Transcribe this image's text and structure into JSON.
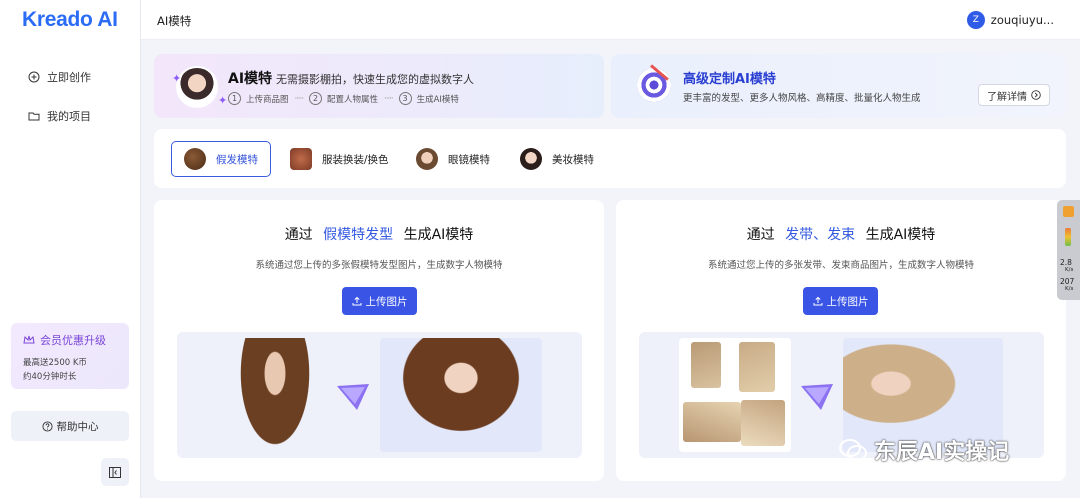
{
  "app": {
    "logo": "Kreado AI",
    "page_title": "AI模特"
  },
  "user": {
    "initial": "Z",
    "name": "zouqiuyu..."
  },
  "sidebar": {
    "items": [
      {
        "label": "立即创作",
        "icon": "plus-circle-icon"
      },
      {
        "label": "我的项目",
        "icon": "folder-icon"
      }
    ],
    "vip": {
      "title": "会员优惠升级",
      "line1": "最高送2500 K币",
      "line2": "约40分钟时长"
    },
    "help": "帮助中心"
  },
  "banner_left": {
    "title": "AI模特",
    "desc": "无需摄影棚拍，快速生成您的虚拟数字人",
    "steps": [
      {
        "num": "1",
        "label": "上传商品图"
      },
      {
        "num": "2",
        "label": "配置人物属性"
      },
      {
        "num": "3",
        "label": "生成AI模特"
      }
    ],
    "dots": "·····"
  },
  "banner_right": {
    "title": "高级定制AI模特",
    "desc": "更丰富的发型、更多人物风格、高精度、批量化人物生成",
    "button": "了解详情"
  },
  "tabs": [
    {
      "label": "假发模特",
      "active": true
    },
    {
      "label": "服装换装/换色",
      "active": false
    },
    {
      "label": "眼镜模特",
      "active": false
    },
    {
      "label": "美妆模特",
      "active": false
    }
  ],
  "cards": [
    {
      "title_prefix": "通过",
      "title_highlight": "假模特发型",
      "title_suffix": "生成AI模特",
      "desc": "系统通过您上传的多张假模特发型图片，生成数字人物模特",
      "button": "上传图片"
    },
    {
      "title_prefix": "通过",
      "title_highlight": "发带、发束",
      "title_suffix": "生成AI模特",
      "desc": "系统通过您上传的多张发带、发束商品图片，生成数字人物模特",
      "button": "上传图片"
    }
  ],
  "widget": {
    "v1": "2.8",
    "u1": "K/s",
    "v2": "207",
    "u2": "K/s"
  },
  "watermark": "东辰AI实操记",
  "colors": {
    "accent": "#3a54e6",
    "brand": "#2b6cf6",
    "vip": "#7a45d8"
  }
}
